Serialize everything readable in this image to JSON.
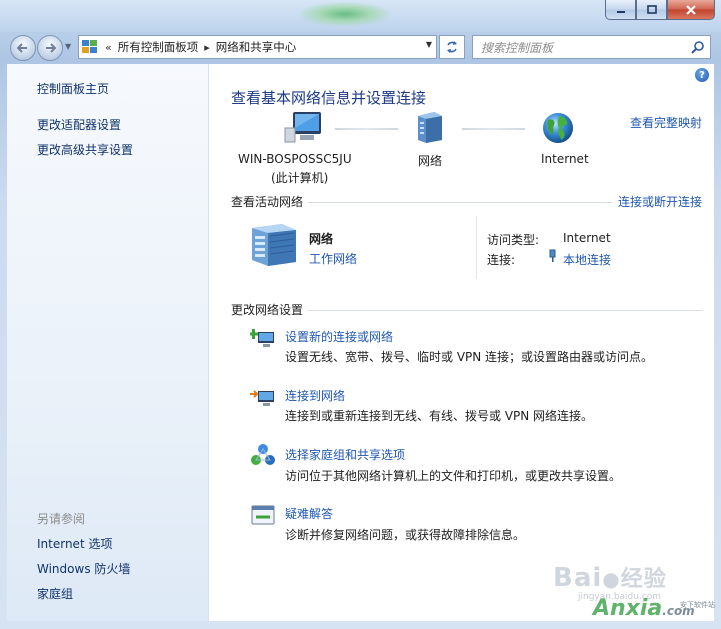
{
  "window": {
    "minimize_icon": "minimize-icon",
    "maximize_icon": "maximize-icon",
    "close_icon": "close-icon"
  },
  "nav": {
    "chevrons": "«",
    "breadcrumb": [
      "所有控制面板项",
      "网络和共享中心"
    ],
    "search_placeholder": "搜索控制面板"
  },
  "sidebar": {
    "top_links": [
      "控制面板主页",
      "更改适配器设置",
      "更改高级共享设置"
    ],
    "see_also_heading": "另请参阅",
    "see_also_links": [
      "Internet 选项",
      "Windows 防火墙",
      "家庭组"
    ]
  },
  "main": {
    "title": "查看基本网络信息并设置连接",
    "view_full_map": "查看完整映射",
    "map": {
      "computer_name": "WIN-BOSPOSSC5JU",
      "computer_sub": "(此计算机)",
      "network": "网络",
      "internet": "Internet"
    },
    "active_heading": "查看活动网络",
    "connect_disconnect": "连接或断开连接",
    "active": {
      "name": "网络",
      "type_link": "工作网络",
      "access_label": "访问类型:",
      "access_value": "Internet",
      "conn_label": "连接:",
      "conn_value": "本地连接"
    },
    "change_heading": "更改网络设置",
    "tasks": [
      {
        "title": "设置新的连接或网络",
        "desc": "设置无线、宽带、拨号、临时或 VPN 连接；或设置路由器或访问点。"
      },
      {
        "title": "连接到网络",
        "desc": "连接到或重新连接到无线、有线、拨号或 VPN 网络连接。"
      },
      {
        "title": "选择家庭组和共享选项",
        "desc": "访问位于其他网络计算机上的文件和打印机，或更改共享设置。"
      },
      {
        "title": "疑难解答",
        "desc": "诊断并修复网络问题，或获得故障排除信息。"
      }
    ]
  },
  "watermark": {
    "baidu": "Bai",
    "baidu_jy": "经验",
    "jingyan_url": "jingyan.baidu.com",
    "anxia": "Anxia",
    "anxia_com": ".com",
    "anxia_tag": "安下软件站"
  },
  "colors": {
    "link": "#1f57b4",
    "title": "#1e3a84",
    "sidebar_link": "#10336b"
  }
}
